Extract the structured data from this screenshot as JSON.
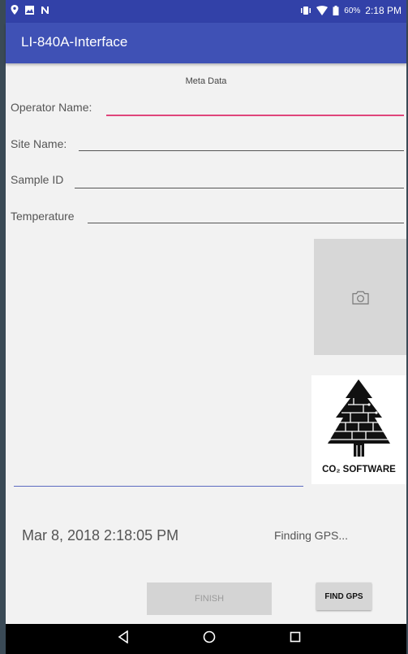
{
  "status_bar": {
    "battery": "60%",
    "time": "2:18 PM",
    "icons_left": [
      "location-icon",
      "image-icon",
      "n-icon"
    ],
    "icons_right": [
      "vibrate-icon",
      "wifi-icon",
      "battery-icon"
    ]
  },
  "app": {
    "title": "LI-840A-Interface",
    "accent": "#3f51b5",
    "status_color": "#3241a8"
  },
  "meta": {
    "header": "Meta Data"
  },
  "fields": [
    {
      "label": "Operator Name:",
      "value": ""
    },
    {
      "label": "Site Name:",
      "value": ""
    },
    {
      "label": "Sample ID",
      "value": ""
    },
    {
      "label": "Temperature",
      "value": ""
    }
  ],
  "photo": {
    "icon": "camera-icon"
  },
  "logo": {
    "text": "CO₂ SOFTWARE"
  },
  "datetime": "Mar 8, 2018 2:18:05 PM",
  "gps_status": "Finding GPS...",
  "buttons": {
    "finish": "FINISH",
    "find_gps": "FIND GPS"
  },
  "nav": {
    "icons": [
      "back-icon",
      "home-icon",
      "recents-icon"
    ]
  }
}
